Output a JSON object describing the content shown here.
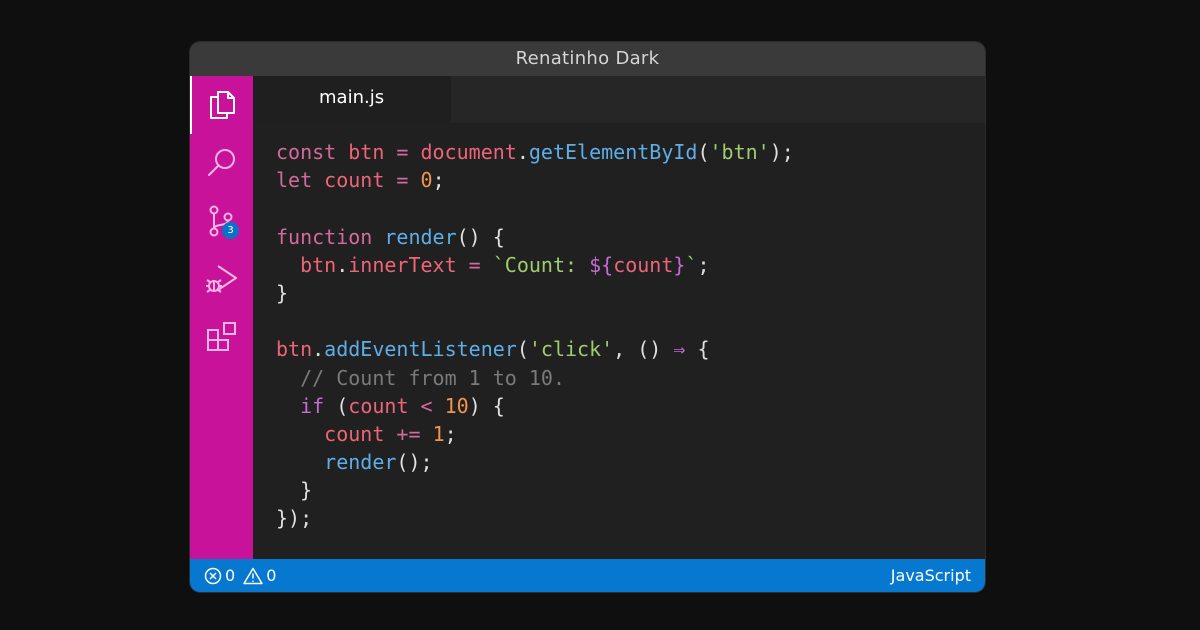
{
  "window": {
    "title": "Renatinho Dark"
  },
  "activity_bar": {
    "items": [
      {
        "icon": "files-icon",
        "active": true
      },
      {
        "icon": "search-icon"
      },
      {
        "icon": "source-control-icon",
        "badge": "3"
      },
      {
        "icon": "run-debug-icon"
      },
      {
        "icon": "extensions-icon"
      }
    ],
    "background": "#c9129a",
    "badge_color": "#0b72c8"
  },
  "editor": {
    "tab": {
      "label": "main.js"
    },
    "code_lines": [
      [
        {
          "t": "const ",
          "c": "kw"
        },
        {
          "t": "btn",
          "c": "var"
        },
        {
          "t": " = ",
          "c": "kw"
        },
        {
          "t": "document",
          "c": "var"
        },
        {
          "t": ".",
          "c": "pl"
        },
        {
          "t": "getElementById",
          "c": "fn"
        },
        {
          "t": "(",
          "c": "pl"
        },
        {
          "t": "'btn'",
          "c": "str"
        },
        {
          "t": ");",
          "c": "pl"
        }
      ],
      [
        {
          "t": "let ",
          "c": "kw"
        },
        {
          "t": "count",
          "c": "var"
        },
        {
          "t": " = ",
          "c": "kw"
        },
        {
          "t": "0",
          "c": "num"
        },
        {
          "t": ";",
          "c": "pl"
        }
      ],
      [],
      [
        {
          "t": "function ",
          "c": "kw"
        },
        {
          "t": "render",
          "c": "fn"
        },
        {
          "t": "() {",
          "c": "pl"
        }
      ],
      [
        {
          "t": "  ",
          "c": "pl"
        },
        {
          "t": "btn",
          "c": "var"
        },
        {
          "t": ".",
          "c": "pl"
        },
        {
          "t": "innerText",
          "c": "var"
        },
        {
          "t": " = ",
          "c": "kw"
        },
        {
          "t": "`Count: ",
          "c": "str"
        },
        {
          "t": "${",
          "c": "kw2"
        },
        {
          "t": "count",
          "c": "var"
        },
        {
          "t": "}",
          "c": "kw2"
        },
        {
          "t": "`",
          "c": "str"
        },
        {
          "t": ";",
          "c": "pl"
        }
      ],
      [
        {
          "t": "}",
          "c": "pl"
        }
      ],
      [],
      [
        {
          "t": "btn",
          "c": "var"
        },
        {
          "t": ".",
          "c": "pl"
        },
        {
          "t": "addEventListener",
          "c": "fn"
        },
        {
          "t": "(",
          "c": "pl"
        },
        {
          "t": "'click'",
          "c": "str"
        },
        {
          "t": ", () ",
          "c": "pl"
        },
        {
          "t": "⇒",
          "c": "kw2"
        },
        {
          "t": " {",
          "c": "pl"
        }
      ],
      [
        {
          "t": "  // Count from 1 to 10.",
          "c": "com"
        }
      ],
      [
        {
          "t": "  ",
          "c": "pl"
        },
        {
          "t": "if",
          "c": "kw2"
        },
        {
          "t": " (",
          "c": "pl"
        },
        {
          "t": "count",
          "c": "var"
        },
        {
          "t": " < ",
          "c": "kw"
        },
        {
          "t": "10",
          "c": "num"
        },
        {
          "t": ") {",
          "c": "pl"
        }
      ],
      [
        {
          "t": "    ",
          "c": "pl"
        },
        {
          "t": "count",
          "c": "var"
        },
        {
          "t": " += ",
          "c": "kw"
        },
        {
          "t": "1",
          "c": "num"
        },
        {
          "t": ";",
          "c": "pl"
        }
      ],
      [
        {
          "t": "    ",
          "c": "pl"
        },
        {
          "t": "render",
          "c": "fn"
        },
        {
          "t": "();",
          "c": "pl"
        }
      ],
      [
        {
          "t": "  }",
          "c": "pl"
        }
      ],
      [
        {
          "t": "});",
          "c": "pl"
        }
      ]
    ]
  },
  "status_bar": {
    "errors": "0",
    "warnings": "0",
    "language": "JavaScript",
    "background": "#0678cf"
  }
}
